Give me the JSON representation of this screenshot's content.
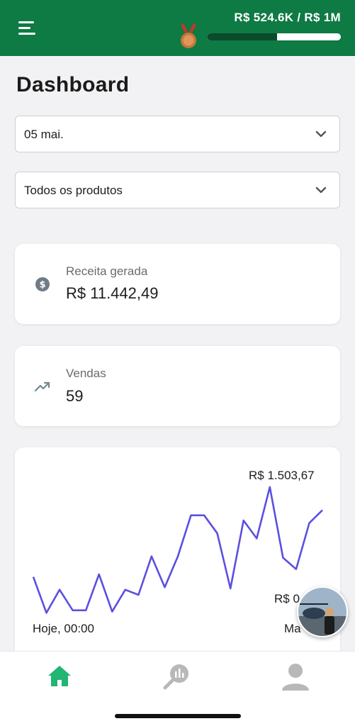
{
  "header": {
    "goal_text": "R$ 524.6K / R$ 1M",
    "goal_progress": 0.525,
    "menu_icon": "hamburger-menu-icon",
    "medal_icon": "bronze-medal-icon",
    "accent_color": "#0e7a44"
  },
  "page": {
    "title": "Dashboard"
  },
  "filters": {
    "date": {
      "value": "05 mai."
    },
    "product": {
      "value": "Todos os produtos"
    }
  },
  "stats": {
    "revenue": {
      "label": "Receita gerada",
      "value": "R$ 11.442,49",
      "icon": "dollar-coin-icon"
    },
    "sales": {
      "label": "Vendas",
      "value": "59",
      "icon": "trending-up-icon"
    }
  },
  "chart_data": {
    "type": "line",
    "max_label": "R$ 1.503,67",
    "min_label": "R$ 0",
    "x_start_label": "Hoje, 00:00",
    "x_end_label": "Ma",
    "color": "#5b4fe0",
    "values": [
      0.3,
      0.02,
      0.2,
      0.04,
      0.04,
      0.32,
      0.03,
      0.2,
      0.16,
      0.46,
      0.22,
      0.46,
      0.78,
      0.78,
      0.64,
      0.21,
      0.74,
      0.6,
      1.0,
      0.45,
      0.36,
      0.72,
      0.82
    ]
  },
  "nav": {
    "items": [
      {
        "name": "home",
        "icon": "home-icon",
        "active": true
      },
      {
        "name": "analytics",
        "icon": "analytics-search-icon",
        "active": false
      },
      {
        "name": "profile",
        "icon": "user-icon",
        "active": false
      }
    ]
  }
}
